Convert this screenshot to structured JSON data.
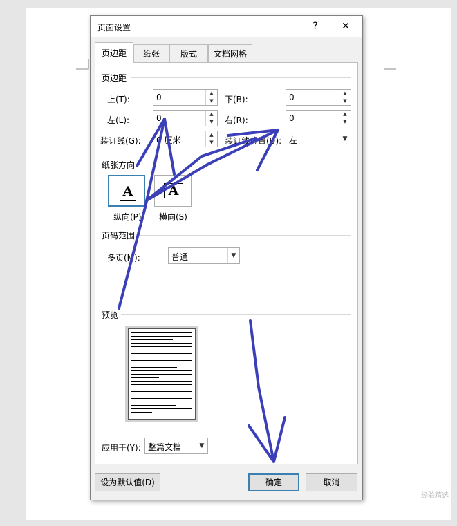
{
  "dialog": {
    "title": "页面设置",
    "help": "?",
    "close": "✕"
  },
  "tabs": [
    {
      "label": "页边距"
    },
    {
      "label": "纸张"
    },
    {
      "label": "版式"
    },
    {
      "label": "文档网格"
    }
  ],
  "margins": {
    "section_label": "页边距",
    "top_label": "上(T):",
    "top_value": "0",
    "bottom_label": "下(B):",
    "bottom_value": "0",
    "left_label": "左(L):",
    "left_value": "0",
    "right_label": "右(R):",
    "right_value": "0",
    "gutter_label": "装订线(G):",
    "gutter_value": "0 厘米",
    "gutter_pos_label": "装订线位置(U):",
    "gutter_pos_value": "左"
  },
  "orientation": {
    "section_label": "纸张方向",
    "portrait_label": "纵向(P)",
    "landscape_label": "横向(S)",
    "glyph": "A"
  },
  "pages": {
    "section_label": "页码范围",
    "multiple_label": "多页(M):",
    "multiple_value": "普通"
  },
  "preview": {
    "section_label": "预览",
    "apply_label": "应用于(Y):",
    "apply_value": "整篇文档"
  },
  "buttons": {
    "set_default": "设为默认值(D)",
    "ok": "确定",
    "cancel": "取消"
  },
  "watermark": "经验精选",
  "colors": {
    "annotation_arrow": "#3b3fb8",
    "default_button_border": "#3c7fb1"
  }
}
